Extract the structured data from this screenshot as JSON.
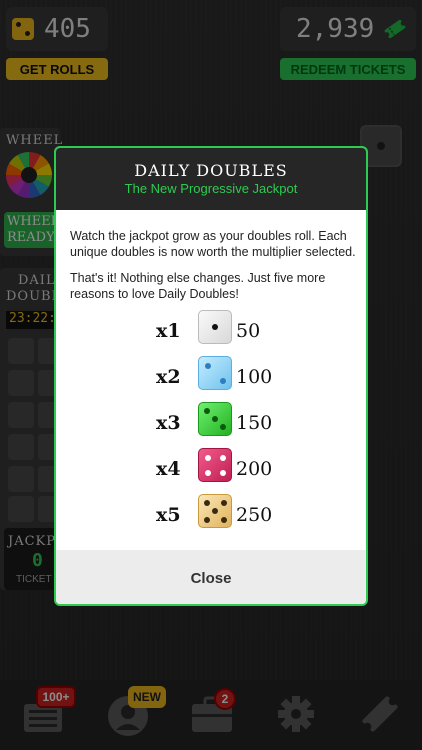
{
  "header": {
    "rolls_value": "405",
    "tickets_value": "2,939",
    "get_rolls_label": "GET ROLLS",
    "redeem_label": "REDEEM TICKETS"
  },
  "background": {
    "wheel_label": "WHEEL",
    "wheel_ready_line1": "WHEEL",
    "wheel_ready_line2": "READY",
    "daily_line1": "DAILY",
    "daily_line2": "DOUBLES",
    "timer": "23:22:2",
    "jackpot_label": "JACKP",
    "jackpot_value": "0",
    "tickets_label": "TICKET"
  },
  "modal": {
    "title": "DAILY DOUBLES",
    "subtitle": "The New Progressive Jackpot",
    "paragraph1": "Watch the jackpot grow as your doubles roll. Each unique doubles is now worth the multiplier selected.",
    "paragraph2": "That's it! Nothing else changes. Just five more reasons to love Daily Doubles!",
    "multipliers": [
      {
        "label": "x1",
        "value": "50",
        "color": "#eeeeee"
      },
      {
        "label": "x2",
        "value": "100",
        "color": "#8fd3f5"
      },
      {
        "label": "x3",
        "value": "150",
        "color": "#3ccf3c"
      },
      {
        "label": "x4",
        "value": "200",
        "color": "#e0336e"
      },
      {
        "label": "x5",
        "value": "250",
        "color": "#f3d28a"
      }
    ],
    "close_label": "Close"
  },
  "nav": {
    "badge_100": "100+",
    "badge_new": "NEW",
    "badge_count": "2"
  },
  "colors": {
    "accent_green": "#2ecb52",
    "gold": "#f2c21c",
    "badge_red": "#d02323"
  }
}
